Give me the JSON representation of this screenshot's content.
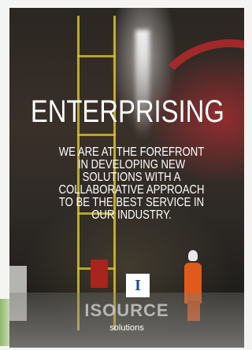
{
  "headline": "ENTERPRISING",
  "body_lines": [
    "WE ARE AT THE FOREFRONT",
    "IN DEVELOPING NEW",
    "SOLUTIONS WITH A",
    "COLLABORATIVE APPROACH",
    "TO BE THE BEST SERVICE IN",
    "OUR INDUSTRY."
  ],
  "logo": {
    "mark": "I",
    "brand_name": "ISOURCE",
    "tagline": "solutions"
  },
  "colors": {
    "logo_blue": "#1b4f8a",
    "text": "#ffffff"
  }
}
